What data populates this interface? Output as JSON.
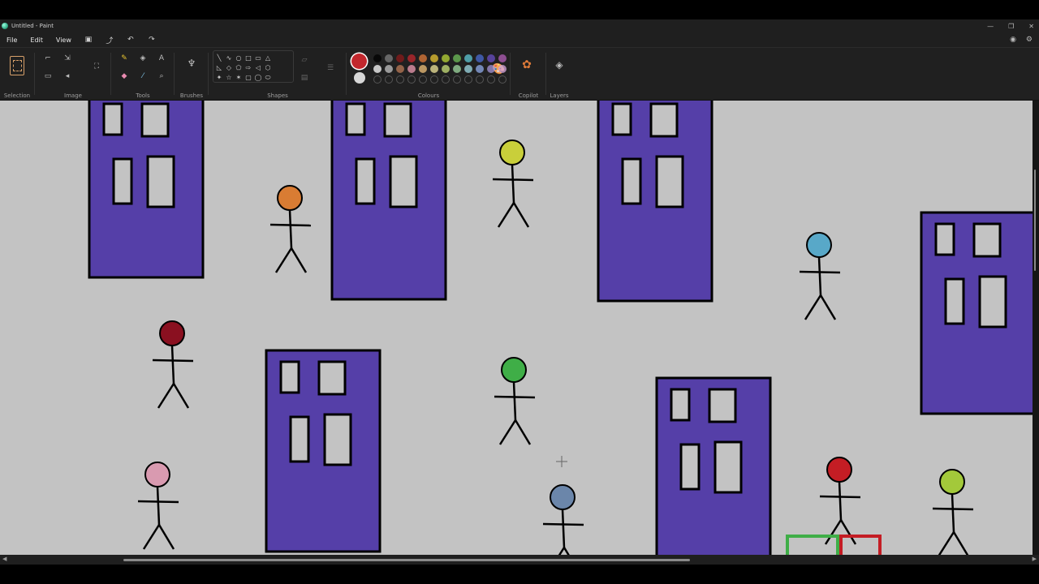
{
  "window": {
    "title": "Untitled - Paint",
    "minimize_icon": "minimize-icon",
    "maximize_icon": "maximize-icon",
    "close_icon": "close-icon"
  },
  "menu": {
    "items": [
      "File",
      "Edit",
      "View"
    ]
  },
  "quick_access": [
    "save-icon",
    "share-icon",
    "undo-icon",
    "redo-icon"
  ],
  "ribbon": {
    "groups": {
      "selection": "Selection",
      "image": "Image",
      "tools": "Tools",
      "brushes": "Brushes",
      "shapes": "Shapes",
      "colours": "Colours",
      "copilot": "Copilot",
      "layers": "Layers"
    },
    "tools_icons": [
      "pencil-icon",
      "fill-icon",
      "text-icon",
      "eraser-icon",
      "color-picker-icon",
      "magnifier-icon"
    ],
    "text_tool_glyph": "A",
    "shapes_glyphs": [
      "╲",
      "∿",
      "○",
      "□",
      "▭",
      "△",
      "◺",
      "◇",
      "⬠",
      "⇨",
      "◁",
      "⬡",
      "✦",
      "☆",
      "✶",
      "▢",
      "◯",
      "⬭"
    ]
  },
  "colours": {
    "current": "#c1272d",
    "secondary": "#d7d7d7",
    "row1": [
      "#000000",
      "#7f7f7f",
      "#8b1a1a",
      "#c1272d",
      "#e07b39",
      "#e8c431",
      "#b9d637",
      "#6fbf5a",
      "#5fc8d6",
      "#4a6bd1",
      "#6a4ec3",
      "#b15db7"
    ],
    "row2": [
      "#ffffff",
      "#c3c3c3",
      "#b97a57",
      "#ee9bb2",
      "#f0c07a",
      "#efe49a",
      "#c8e07a",
      "#9fd9a0",
      "#9fdbe6",
      "#8fa9e8",
      "#a494d8",
      "#d7a6dd"
    ]
  },
  "canvas": {
    "background": "#c3c3c3",
    "building_fill": "#553fa8",
    "window_fill": "#c3c3c3",
    "head_colors": {
      "orange": "#d97c33",
      "yellow": "#c9cf3a",
      "cyan": "#58a8c8",
      "maroon": "#8a1020",
      "green": "#3fae47",
      "pink": "#d99ab0",
      "slate": "#6b86aa",
      "red": "#c41d24",
      "lime": "#a3c93a"
    },
    "selection_green": "#3fae47",
    "selection_red": "#c41d24"
  }
}
